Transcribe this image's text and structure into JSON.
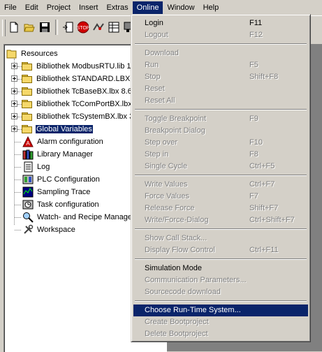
{
  "menubar": [
    "File",
    "Edit",
    "Project",
    "Insert",
    "Extras",
    "Online",
    "Window",
    "Help"
  ],
  "active_menu": "Online",
  "tree": {
    "root": "Resources",
    "folders": [
      "Bibliothek ModbusRTU.lib 12",
      "Bibliothek STANDARD.LBX",
      "Bibliothek TcBaseBX.lbx 8.6",
      "Bibliothek TcComPortBX.lbx",
      "Bibliothek TcSystemBX.lbx 3",
      "Global Variables"
    ],
    "items": [
      "Alarm configuration",
      "Library Manager",
      "Log",
      "PLC Configuration",
      "Sampling Trace",
      "Task configuration",
      "Watch- and Recipe Manage",
      "Workspace"
    ]
  },
  "menu": {
    "groups": [
      [
        {
          "label": "Login",
          "shortcut": "F11",
          "enabled": true
        },
        {
          "label": "Logout",
          "shortcut": "F12",
          "enabled": false
        }
      ],
      [
        {
          "label": "Download",
          "shortcut": "",
          "enabled": false
        },
        {
          "label": "Run",
          "shortcut": "F5",
          "enabled": false
        },
        {
          "label": "Stop",
          "shortcut": "Shift+F8",
          "enabled": false
        },
        {
          "label": "Reset",
          "shortcut": "",
          "enabled": false
        },
        {
          "label": "Reset All",
          "shortcut": "",
          "enabled": false
        }
      ],
      [
        {
          "label": "Toggle Breakpoint",
          "shortcut": "F9",
          "enabled": false
        },
        {
          "label": "Breakpoint Dialog",
          "shortcut": "",
          "enabled": false
        },
        {
          "label": "Step over",
          "shortcut": "F10",
          "enabled": false
        },
        {
          "label": "Step in",
          "shortcut": "F8",
          "enabled": false
        },
        {
          "label": "Single Cycle",
          "shortcut": "Ctrl+F5",
          "enabled": false
        }
      ],
      [
        {
          "label": "Write Values",
          "shortcut": "Ctrl+F7",
          "enabled": false
        },
        {
          "label": "Force Values",
          "shortcut": "F7",
          "enabled": false
        },
        {
          "label": "Release Force",
          "shortcut": "Shift+F7",
          "enabled": false
        },
        {
          "label": "Write/Force-Dialog",
          "shortcut": "Ctrl+Shift+F7",
          "enabled": false
        }
      ],
      [
        {
          "label": "Show Call Stack...",
          "shortcut": "",
          "enabled": false
        },
        {
          "label": "Display Flow Control",
          "shortcut": "Ctrl+F11",
          "enabled": false
        }
      ],
      [
        {
          "label": "Simulation Mode",
          "shortcut": "",
          "enabled": true
        },
        {
          "label": "Communication Parameters...",
          "shortcut": "",
          "enabled": false
        },
        {
          "label": "Sourcecode download",
          "shortcut": "",
          "enabled": false
        }
      ],
      [
        {
          "label": "Choose Run-Time System...",
          "shortcut": "",
          "enabled": true,
          "highlighted": true
        },
        {
          "label": "Create Bootproject",
          "shortcut": "",
          "enabled": false
        },
        {
          "label": "Delete Bootproject",
          "shortcut": "",
          "enabled": false
        }
      ]
    ]
  },
  "colors": {
    "highlight": "#0a246a",
    "face": "#d4d0c8"
  }
}
